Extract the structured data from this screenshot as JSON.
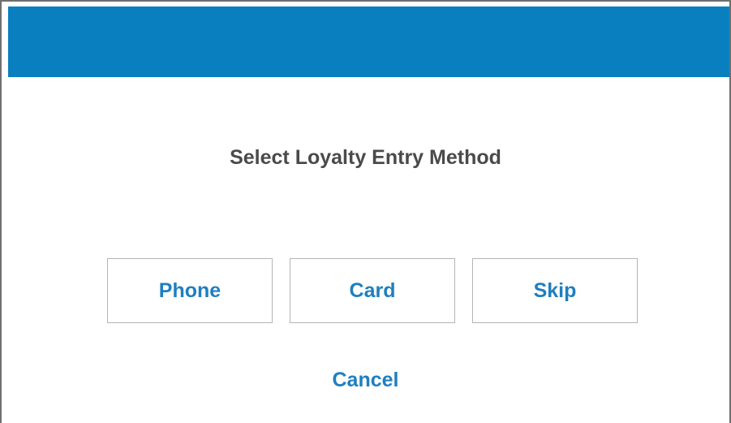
{
  "dialog": {
    "prompt": "Select Loyalty Entry Method",
    "options": {
      "phone_label": "Phone",
      "card_label": "Card",
      "skip_label": "Skip"
    },
    "cancel_label": "Cancel"
  },
  "colors": {
    "title_bar": "#0a7fc0",
    "accent_text": "#1f7fbf",
    "prompt_text": "#4a4a4a",
    "button_border": "#b4b4b4"
  }
}
